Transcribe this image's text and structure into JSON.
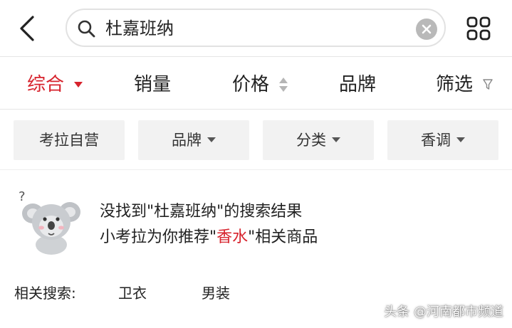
{
  "header": {
    "back_icon": "chevron-left-icon",
    "search_icon": "search-icon",
    "query": "杜嘉班纳",
    "clear_icon": "clear-icon",
    "grid_icon": "grid-icon"
  },
  "sortbar": {
    "items": [
      {
        "label": "综合",
        "active": true,
        "indicator": "caret-down"
      },
      {
        "label": "销量"
      },
      {
        "label": "价格",
        "indicator": "sort-updown"
      },
      {
        "label": "品牌"
      },
      {
        "label": "筛选",
        "indicator": "funnel"
      }
    ],
    "active_color": "#d7232d"
  },
  "chips": [
    {
      "label": "考拉自营"
    },
    {
      "label": "品牌"
    },
    {
      "label": "分类"
    },
    {
      "label": "香调"
    }
  ],
  "empty_state": {
    "mascot": "koala-mascot",
    "line1": "没找到\"杜嘉班纳\"的搜索结果",
    "line2_prefix": "小考拉为你推荐\"",
    "line2_highlight": "香水",
    "line2_suffix": "\"相关商品",
    "highlight_color": "#d7232d"
  },
  "related": {
    "label": "相关搜索:",
    "items": [
      "卫衣",
      "男装"
    ]
  },
  "watermark": "头条 @河南都市频道"
}
